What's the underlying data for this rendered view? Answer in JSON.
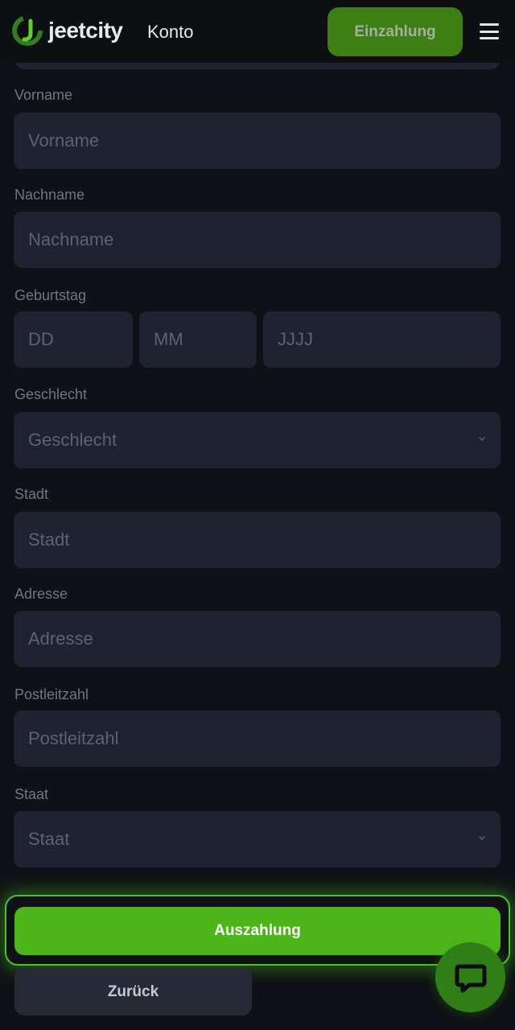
{
  "header": {
    "brand": "jeetcity",
    "title": "Konto",
    "deposit_label": "Einzahlung"
  },
  "form": {
    "first_name": {
      "label": "Vorname",
      "placeholder": "Vorname"
    },
    "last_name": {
      "label": "Nachname",
      "placeholder": "Nachname"
    },
    "birthday": {
      "label": "Geburtstag",
      "day": "DD",
      "month": "MM",
      "year": "JJJJ"
    },
    "gender": {
      "label": "Geschlecht",
      "placeholder": "Geschlecht"
    },
    "city": {
      "label": "Stadt",
      "placeholder": "Stadt"
    },
    "address": {
      "label": "Adresse",
      "placeholder": "Adresse"
    },
    "postal_code": {
      "label": "Postleitzahl",
      "placeholder": "Postleitzahl"
    },
    "state": {
      "label": "Staat",
      "placeholder": "Staat"
    }
  },
  "actions": {
    "payout_label": "Auszahlung",
    "back_label": "Zurück"
  },
  "icons": {
    "logo": "jeetcity-logo-icon",
    "menu": "hamburger-menu-icon",
    "dropdown": "chevron-down-icon",
    "chat": "chat-bubble-icon"
  },
  "colors": {
    "accent": "#4bb51a",
    "deposit": "#3d7f13",
    "field_bg": "#1f2230",
    "page_bg": "#0f1116"
  }
}
